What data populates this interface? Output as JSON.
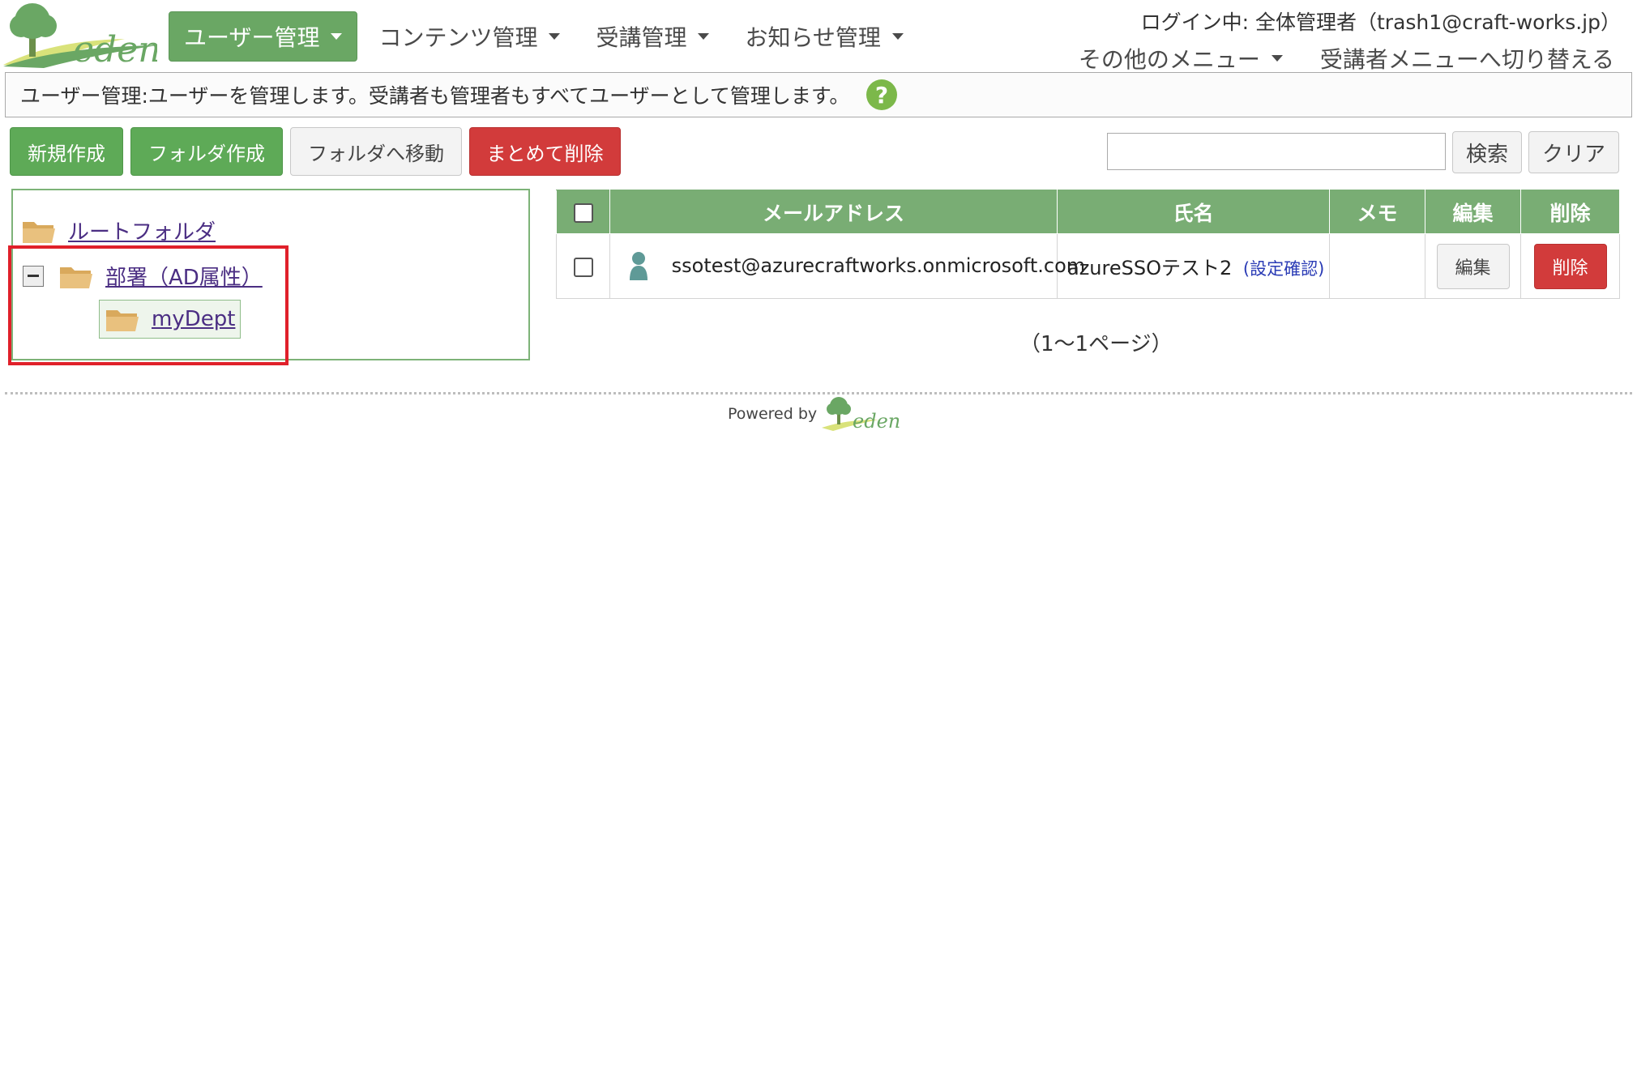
{
  "brand": {
    "logo_text": "eden",
    "primary_color": "#6aa764",
    "danger_color": "#d23b3b"
  },
  "nav": {
    "items": [
      {
        "label": "ユーザー管理",
        "active": true
      },
      {
        "label": "コンテンツ管理",
        "active": false
      },
      {
        "label": "受講管理",
        "active": false
      },
      {
        "label": "お知らせ管理",
        "active": false
      }
    ]
  },
  "header": {
    "login_info": "ログイン中: 全体管理者（trash1@craft-works.jp）",
    "other_menu": "その他のメニュー",
    "switch_menu": "受講者メニューへ切り替える"
  },
  "info_bar": {
    "text": "ユーザー管理:ユーザーを管理します。受講者も管理者もすべてユーザーとして管理します。"
  },
  "toolbar": {
    "new_label": "新規作成",
    "new_folder_label": "フォルダ作成",
    "move_label": "フォルダへ移動",
    "bulk_delete_label": "まとめて削除",
    "search_value": "",
    "search_label": "検索",
    "clear_label": "クリア"
  },
  "tree": {
    "root": "ルートフォルダ",
    "department": "部署（AD属性）",
    "child": "myDept"
  },
  "table": {
    "headers": {
      "email": "メールアドレス",
      "name": "氏名",
      "memo": "メモ",
      "edit": "編集",
      "delete": "削除"
    },
    "rows": [
      {
        "email": "ssotest@azurecraftworks.onmicrosoft.com",
        "name": "azureSSOテスト2",
        "confirm": "(設定確認)",
        "memo": "",
        "edit_label": "編集",
        "delete_label": "削除"
      }
    ]
  },
  "pagination": {
    "text": "（1～1ページ）"
  },
  "footer": {
    "powered_by": "Powered by"
  }
}
